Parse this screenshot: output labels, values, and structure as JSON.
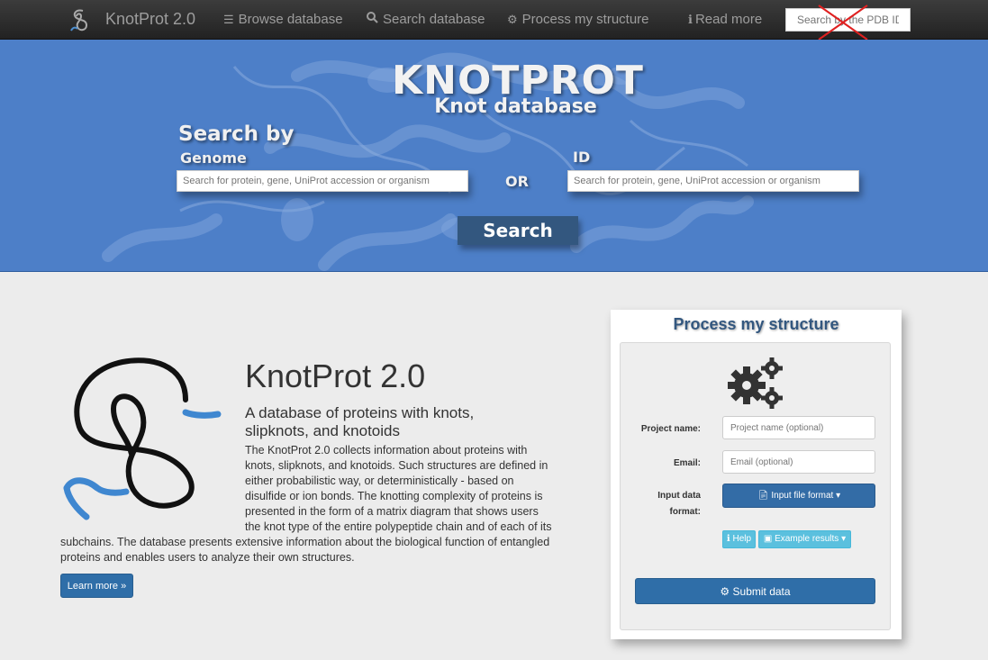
{
  "navbar": {
    "brand": "KnotProt 2.0",
    "items": [
      {
        "icon": "list-icon",
        "glyph": "☰",
        "label": "Browse database"
      },
      {
        "icon": "search-icon",
        "glyph": "🔍︎",
        "label": "Search database"
      },
      {
        "icon": "cogs-icon",
        "glyph": "⚙",
        "label": "Process my structure"
      },
      {
        "icon": "info-icon",
        "glyph": "ℹ",
        "label": "Read more"
      }
    ],
    "search_placeholder": "Search by the PDB ID.."
  },
  "hero": {
    "title": "KNOTPROT",
    "subtitle": "Knot database",
    "search_by": "Search by",
    "genome_label": "Genome",
    "id_label": "ID",
    "or_label": "OR",
    "genome_placeholder": "Search for protein, gene, UniProt accession or organism",
    "id_placeholder": "Search for protein, gene, UniProt accession or organism",
    "search_button": "Search"
  },
  "main": {
    "title": "KnotProt 2.0",
    "lead": "A database of proteins with knots, slipknots, and knotoids",
    "description_lines": [
      "The KnotProt 2.0 collects information about proteins with",
      "knots, slipknots, and knotoids. Such structures are defined in",
      "either probabilistic way, or deterministically - based on",
      "disulfide or ion bonds. The knotting complexity of proteins is",
      "presented in the form of a matrix diagram that shows users",
      "the knot type of the entire polypeptide chain and of each of its"
    ],
    "description_tail": [
      "subchains. The database presents extensive information about the biological function of entangled",
      "proteins and enables users to analyze their own structures."
    ],
    "learn_more": "Learn more »"
  },
  "process": {
    "title": "Process my structure",
    "project_label": "Project name:",
    "project_placeholder": "Project name (optional)",
    "email_label": "Email:",
    "email_placeholder": "Email (optional)",
    "input_label_line1": "Input data",
    "input_label_line2": "format:",
    "input_format_button": "Input file format",
    "help_button": "Help",
    "example_button": "Example results",
    "submit_button": "Submit data"
  },
  "colors": {
    "navbar": "#222222",
    "hero": "#4d7fc8",
    "primary": "#2f6ea8",
    "info": "#5bc0de",
    "panel_title": "#33577f"
  }
}
